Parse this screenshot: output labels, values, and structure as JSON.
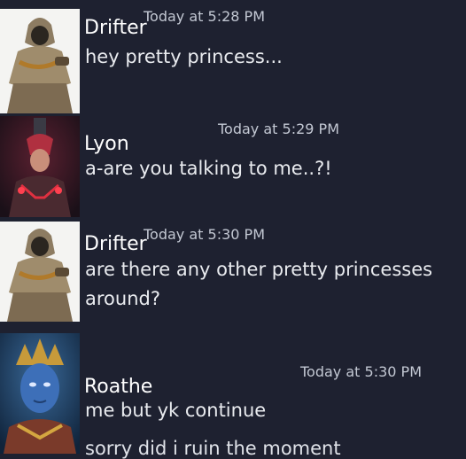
{
  "messages": [
    {
      "author": "Drifter",
      "timestamp": "Today at 5:28 PM",
      "lines": [
        "hey pretty princess..."
      ],
      "avatar": "drifter-avatar"
    },
    {
      "author": "Lyon",
      "timestamp": "Today at 5:29 PM",
      "lines": [
        "a-are you talking to me..?!"
      ],
      "avatar": "lyon-avatar"
    },
    {
      "author": "Drifter",
      "timestamp": "Today at 5:30 PM",
      "lines": [
        "are there any other pretty princesses",
        "around?"
      ],
      "avatar": "drifter-avatar"
    },
    {
      "author": "Roathe",
      "timestamp": "Today at 5:30 PM",
      "lines": [
        "me but yk continue",
        "sorry did i ruin the moment"
      ],
      "avatar": "roathe-avatar"
    }
  ],
  "colors": {
    "background": "#1e2130",
    "author": "#ffffff",
    "timestamp": "#c3c8d3",
    "message_text": "#e9ebef"
  }
}
